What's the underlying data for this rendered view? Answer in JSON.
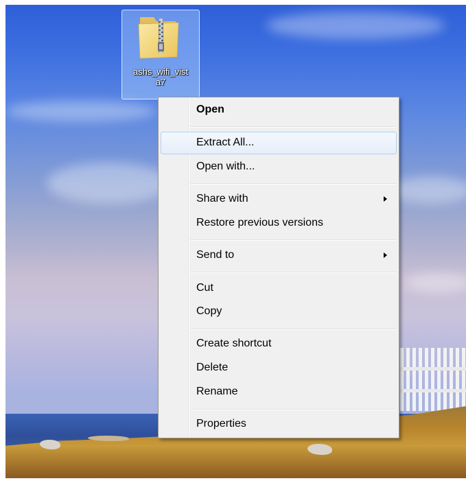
{
  "desktop": {
    "icon": {
      "name_line1": "ashs_wifi_vist",
      "name_line2": "a7",
      "icon": "zip-folder-icon"
    }
  },
  "context_menu": {
    "items": [
      {
        "label": "Open",
        "bold": true
      },
      {
        "label": "Extract All...",
        "highlighted": true
      },
      {
        "label": "Open with..."
      },
      {
        "label": "Share with",
        "submenu": true
      },
      {
        "label": "Restore previous versions"
      },
      {
        "label": "Send to",
        "submenu": true
      },
      {
        "label": "Cut"
      },
      {
        "label": "Copy"
      },
      {
        "label": "Create shortcut"
      },
      {
        "label": "Delete"
      },
      {
        "label": "Rename"
      },
      {
        "label": "Properties"
      }
    ]
  },
  "colors": {
    "menu_background": "#f0f0f0",
    "menu_border": "#979797",
    "highlight_border": "#aecff7",
    "icon_selection": "#add0ff"
  }
}
